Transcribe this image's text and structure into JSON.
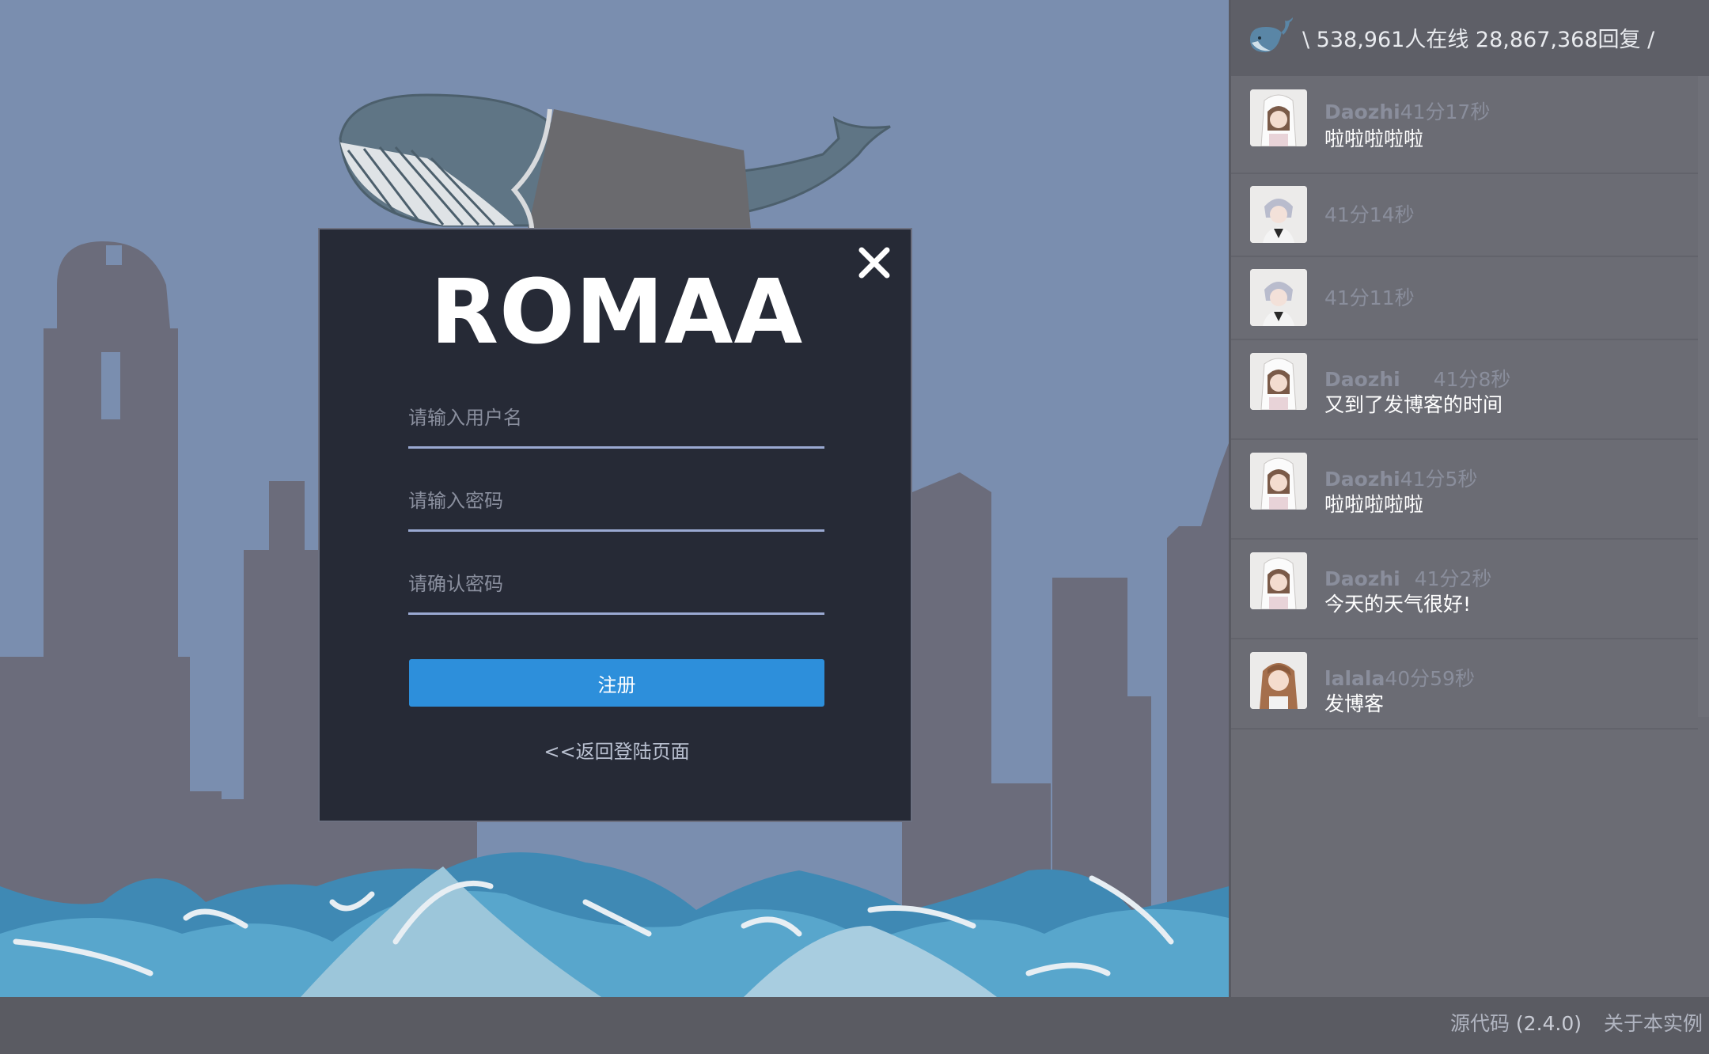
{
  "modal": {
    "title": "ROMAA",
    "close_label": "×",
    "username_placeholder": "请输入用户名",
    "password_placeholder": "请输入密码",
    "confirm_placeholder": "请确认密码",
    "register_label": "注册",
    "back_link": "<<返回登陆页面"
  },
  "panel": {
    "stats": "\\ 538,961人在线 28,867,368回复 /",
    "messages": [
      {
        "name": "Daozhi",
        "time": "41分17秒",
        "text": "啦啦啦啦啦"
      },
      {
        "name": "",
        "time": "41分14秒",
        "text": ""
      },
      {
        "name": "",
        "time": "41分11秒",
        "text": ""
      },
      {
        "name": "Daozhi",
        "time": "41分8秒",
        "text": "又到了发博客的时间"
      },
      {
        "name": "Daozhi",
        "time": "41分5秒",
        "text": "啦啦啦啦啦"
      },
      {
        "name": "Daozhi",
        "time": "41分2秒",
        "text": "今天的天气很好!"
      },
      {
        "name": "lalala",
        "time": "40分59秒",
        "text": "发博客"
      }
    ]
  },
  "footer": {
    "source": "源代码",
    "version": "(2.4.0)",
    "about": "关于本实例"
  },
  "colors": {
    "sky": "#7a8eaf",
    "modal_bg": "#262a36",
    "button": "#2d8fdb",
    "panel_bg": "#6b6c74"
  }
}
